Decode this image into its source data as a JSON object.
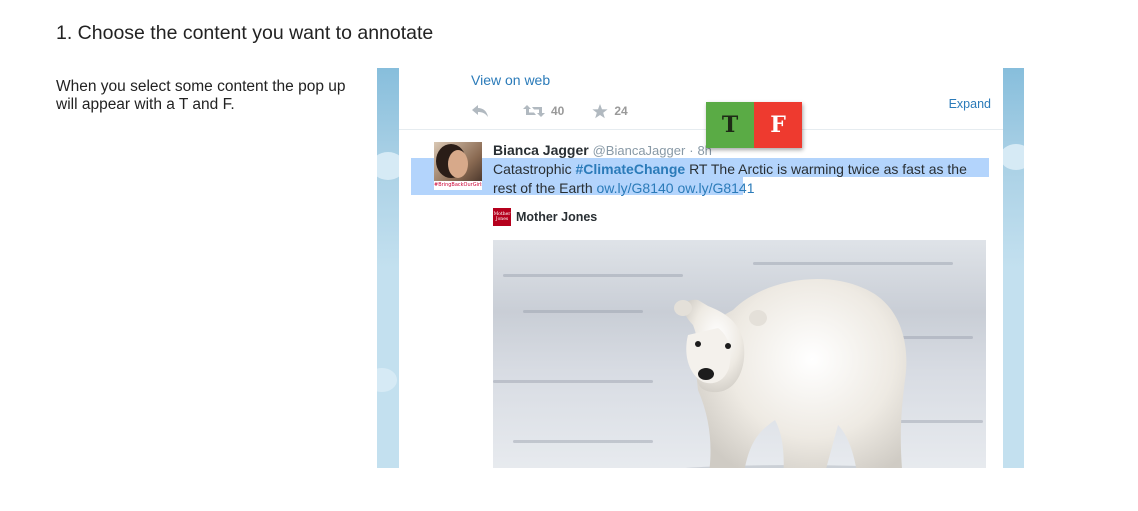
{
  "step": {
    "title": "1. Choose the content you want to annotate"
  },
  "instructions": {
    "text": "When you select some content the pop up will appear with a T and F."
  },
  "tweet_embed": {
    "view_on_web": "View on web",
    "actions": {
      "reply_icon": "reply-icon",
      "retweet_icon": "retweet-icon",
      "retweet_count": "40",
      "favorite_icon": "star-icon",
      "favorite_count": "24"
    },
    "expand": "Expand",
    "author": {
      "name": "Bianca Jagger",
      "handle": "@BiancaJagger",
      "separator": "·",
      "time": "8h"
    },
    "text": {
      "prefix": "Catastrophic ",
      "hashtag": "#ClimateChange",
      "body": " RT The Arctic is warming twice as fast as the rest of the Earth ",
      "link1": "ow.ly/G8140",
      "link2": "ow.ly/G8141"
    },
    "card": {
      "publisher": "Mother Jones",
      "publisher_logo_line1": "Mother",
      "publisher_logo_line2": "Jones"
    },
    "avatar_caption": "#BringBackOurGirls"
  },
  "annotation_popup": {
    "true_label": "T",
    "false_label": "F",
    "true_color": "#5aab45",
    "false_color": "#ee3a2f"
  },
  "colors": {
    "link": "#2b7bb9",
    "selection": "#b3d4fc"
  }
}
